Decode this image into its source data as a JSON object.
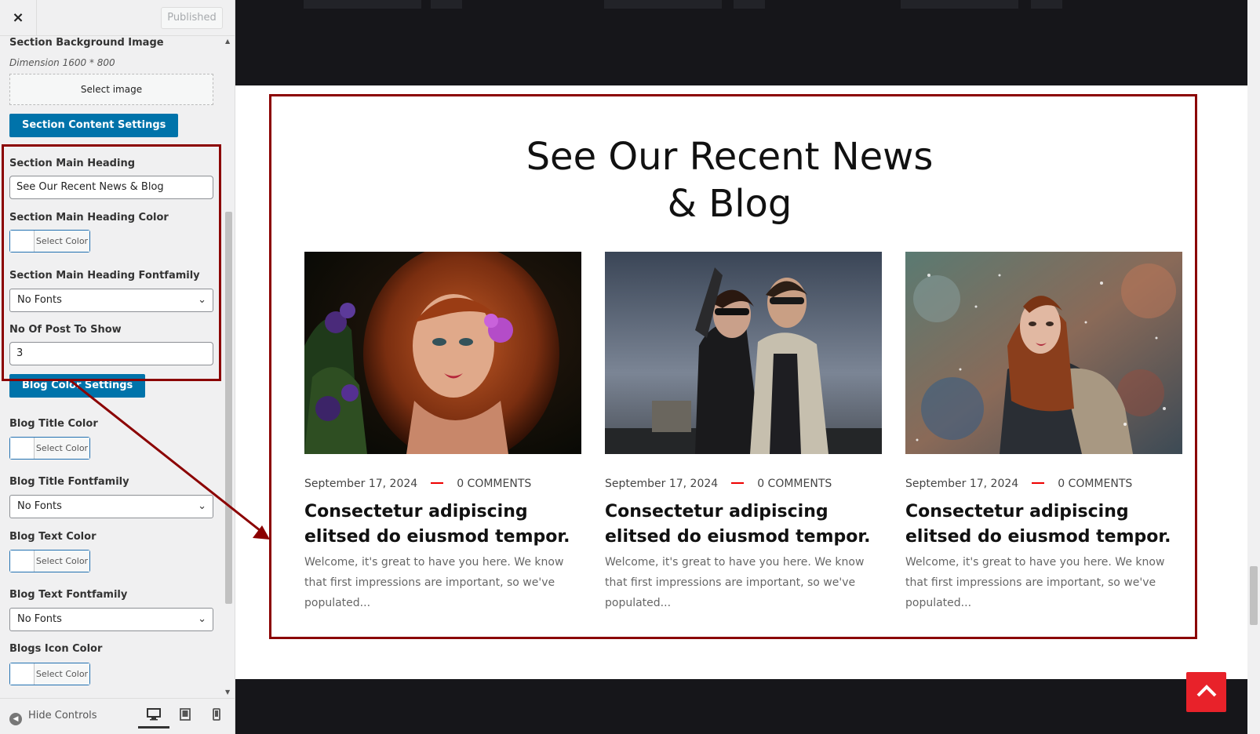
{
  "topbar": {
    "close_icon": "×",
    "publish_label": "Published"
  },
  "controls": {
    "bg_image_label": "Section Background Image",
    "bg_image_dimension": "Dimension 1600 * 800",
    "select_image_label": "Select image",
    "content_settings_label": "Section Content Settings",
    "main_heading_label": "Section Main Heading",
    "main_heading_value": "See Our Recent News & Blog",
    "main_heading_color_label": "Section Main Heading Color",
    "select_color_label": "Select Color",
    "main_heading_font_label": "Section Main Heading Fontfamily",
    "no_fonts": "No Fonts",
    "posts_label": "No Of Post To Show",
    "posts_value": "3",
    "blog_color_settings_label": "Blog Color Settings",
    "blog_title_color_label": "Blog Title Color",
    "blog_title_font_label": "Blog Title Fontfamily",
    "blog_text_color_label": "Blog Text Color",
    "blog_text_font_label": "Blog Text Fontfamily",
    "blogs_icon_color_label": "Blogs Icon Color"
  },
  "footer": {
    "hide_controls_label": "Hide Controls"
  },
  "preview": {
    "heading_line1": "See Our Recent News",
    "heading_line2": "& Blog",
    "posts": [
      {
        "date": "September 17, 2024",
        "comments": "0 COMMENTS",
        "title": "Consectetur adipiscing elitsed do eiusmod tempor.",
        "excerpt": "Welcome, it's great to have you here. We know that first impressions are important, so we've populated..."
      },
      {
        "date": "September 17, 2024",
        "comments": "0 COMMENTS",
        "title": "Consectetur adipiscing elitsed do eiusmod tempor.",
        "excerpt": "Welcome, it's great to have you here. We know that first impressions are important, so we've populated..."
      },
      {
        "date": "September 17, 2024",
        "comments": "0 COMMENTS",
        "title": "Consectetur adipiscing elitsed do eiusmod tempor.",
        "excerpt": "Welcome, it's great to have you here. We know that first impressions are important, so we've populated..."
      }
    ]
  },
  "colors": {
    "accent": "#0073aa",
    "highlight": "#8b0000",
    "dash": "#e00000",
    "to_top": "#e8222a"
  },
  "icons": {
    "close": "close-icon",
    "collapse": "collapse-arrow-icon",
    "desktop": "desktop-icon",
    "tablet": "tablet-icon",
    "mobile": "mobile-icon",
    "back_to_top": "chevron-up-icon",
    "dropdown": "chevron-down-icon"
  }
}
